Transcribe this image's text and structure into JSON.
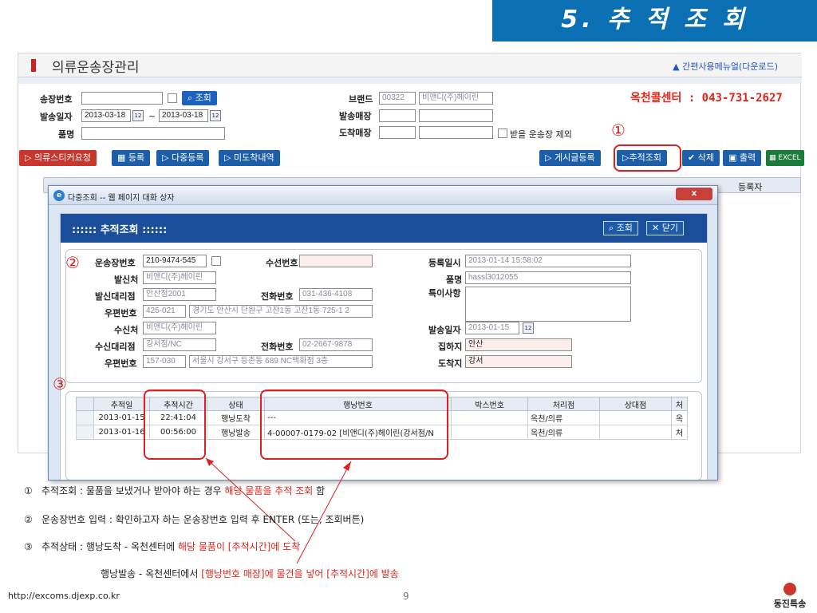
{
  "slide": {
    "title": "5. 추 적 조 회",
    "url": "http://excoms.djexp.co.kr",
    "page": "9",
    "logo": "동진특송"
  },
  "app": {
    "title": "의류운송장관리",
    "manual_link": "간편사용메뉴얼(다운로드)",
    "phone": "옥천콜센터 : 043-731-2627",
    "search": {
      "waybill_label": "송장번호",
      "search_btn": "조회",
      "date_label": "발송일자",
      "date_from": "2013-03-18",
      "tilde": "~",
      "date_to": "2013-03-18",
      "item_label": "품명",
      "brand_label": "브랜드",
      "brand_code": "00322",
      "brand_name": "비앤디(주)헤이린",
      "send_store_label": "발송매장",
      "arrive_store_label": "도착매장",
      "exclude_label": "받을 운송장 제외"
    },
    "toolbar": {
      "sticker": "의류스티커요청",
      "register": "등록",
      "multi_register": "다중등록",
      "unarrived": "미도착내역",
      "board": "게시글등록",
      "track": "추적조회",
      "delete": "삭제",
      "print": "출력",
      "excel": "EXCEL"
    },
    "grid": {
      "reg_col": "등록자"
    }
  },
  "dialog": {
    "window_title": "다중조회 -- 웹 페이지 대화 상자",
    "close": "x",
    "header": ":::::: 추적조회 ::::::",
    "search_btn": "조회",
    "close_btn": "닫기",
    "form": {
      "waybill_label": "운송장번호",
      "waybill": "210-9474-545",
      "receiver_no_label": "수선번호",
      "reg_date_label": "등록일시",
      "reg_date": "2013-01-14 15:58:02",
      "sender_label": "발신처",
      "sender": "비앤디(주)헤이린",
      "item_label": "품명",
      "item": "hassl3012055",
      "sender_agent_label": "발신대리점",
      "sender_agent": "안산점2001",
      "phone_label": "전화번호",
      "phone1": "031-436-4108",
      "note_label": "특이사항",
      "zip_label": "우편번호",
      "zip1": "425-021",
      "addr1": "경기도 안산시 단원구 고잔1동 고잔1동 725-1 2",
      "receiver_label": "수신처",
      "receiver": "비앤디(주)헤이린",
      "ship_date_label": "발송일자",
      "ship_date": "2013-01-15",
      "receiver_agent_label": "수신대리점",
      "receiver_agent": "강서점/NC",
      "phone2": "02-2667-9878",
      "origin_label": "집하지",
      "origin": "안산",
      "zip2": "157-030",
      "addr2": "서울시 강서구 등촌동 689 NC백화점 3층",
      "dest_label": "도착지",
      "dest": "강서"
    },
    "table": {
      "headers": [
        "",
        "추적일",
        "추적시간",
        "상태",
        "행낭번호",
        "박스번호",
        "처리점",
        "상대점",
        "처"
      ],
      "rows": [
        [
          "",
          "2013-01-15",
          "22:41:04",
          "행낭도착",
          "---",
          "",
          "옥천/의류",
          "",
          "옥"
        ],
        [
          "",
          "2013-01-16",
          "00:56:00",
          "행낭발송",
          "4-00007-0179-02 [비앤디(주)헤이린(강서점/N",
          "",
          "옥천/의류",
          "",
          "처"
        ]
      ]
    }
  },
  "markers": {
    "m1": "①",
    "m2": "②",
    "m3": "③"
  },
  "notes": {
    "n1_num": "①",
    "n1_a": "추적조회 : 물품을 보냈거나 받아야 하는 경우 ",
    "n1_hl": "해당 물품을 추적 조회",
    "n1_b": " 함",
    "n2_num": "②",
    "n2": "운송장번호 입력 : 확인하고자 하는 운송장번호 입력 후 ENTER (또는, 조회버튼)",
    "n3_num": "③",
    "n3_a": "추적상태 : 행낭도착 - 옥천센터에 ",
    "n3_hl": "해당 물품이 [추적시간]에 도착",
    "n4_a": "행낭발송 - 옥천센터에서 ",
    "n4_hl": "[행낭번호 매장]에 물건을 넣어 [추적시간]에 발송"
  }
}
